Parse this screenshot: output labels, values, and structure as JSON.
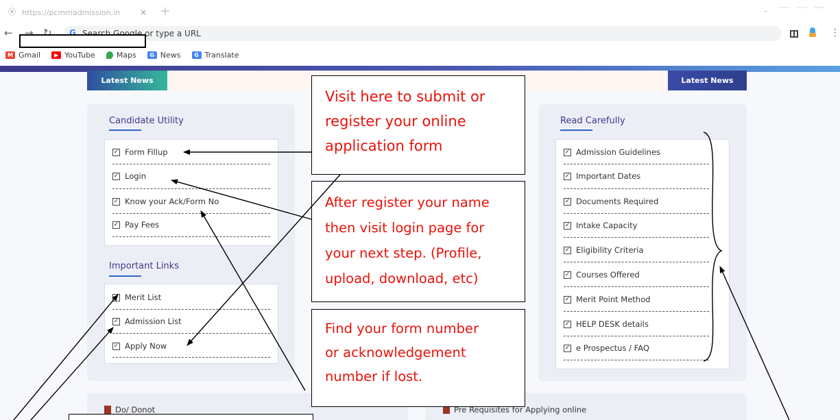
{
  "browser": {
    "tab_title": "https://pcmmadmission.in",
    "tab_close": "×",
    "new_tab": "+",
    "tab_menu": "⌄",
    "omnibox_placeholder": "Search Google or type a URL",
    "bookmarks": [
      {
        "label": "Gmail",
        "icon": "gmail-icon",
        "color": "#EA4335"
      },
      {
        "label": "YouTube",
        "icon": "youtube-icon",
        "color": "#FF0000"
      },
      {
        "label": "Maps",
        "icon": "maps-icon",
        "color": "#34A853"
      },
      {
        "label": "News",
        "icon": "news-icon",
        "color": "#4285F4"
      },
      {
        "label": "Translate",
        "icon": "translate-icon",
        "color": "#4285F4"
      }
    ]
  },
  "news": {
    "left_label": "Latest News",
    "right_label": "Latest News"
  },
  "candidate_utility": {
    "title": "Candidate Utility",
    "items": [
      "Form Fillup",
      "Login",
      "Know your Ack/Form No",
      "Pay Fees"
    ]
  },
  "important_links": {
    "title": "Important Links",
    "items": [
      "Merit List",
      "Admission List",
      "Apply Now"
    ]
  },
  "read_carefully": {
    "title": "Read Carefully",
    "items": [
      "Admission Guidelines",
      "Important Dates",
      "Documents Required",
      "Intake Capacity",
      "Eligibility Criteria",
      "Courses Offered",
      "Merit Point Method",
      "HELP DESK details",
      "e Prospectus / FAQ"
    ]
  },
  "bottom": {
    "do_donot": "Do/ Donot",
    "pre_requisites": "Pre Requisites for Applying online"
  },
  "callouts": {
    "submit": [
      "Visit here to submit or",
      "register your online",
      "application form"
    ],
    "login": [
      "After register your name",
      "then visit login page for",
      "your next step. (Profile,",
      "upload, download, etc)"
    ],
    "find": [
      "Find your form number",
      "or acknowledgement",
      "number if lost."
    ]
  },
  "colors": {
    "annotation_text": "#E8120A",
    "panel_bg": "#ECEEF6",
    "title_text": "#3A3A88",
    "accent_underline": "#2F66C6"
  }
}
